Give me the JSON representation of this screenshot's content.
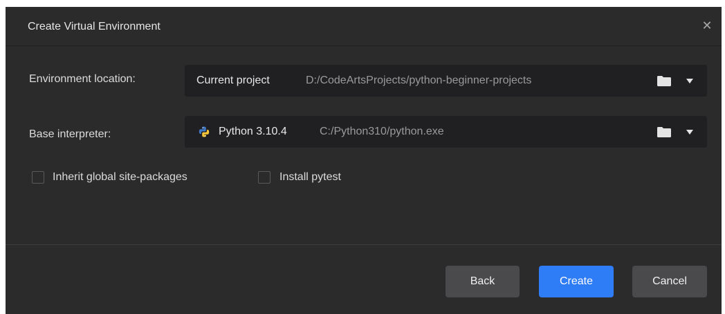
{
  "dialog": {
    "title": "Create Virtual Environment",
    "close_icon": "close-icon"
  },
  "environment_location": {
    "label": "Environment location:",
    "primary": "Current project",
    "path": "D:/CodeArtsProjects/python-beginner-projects"
  },
  "base_interpreter": {
    "label": "Base interpreter:",
    "primary": "Python 3.10.4",
    "path": "C:/Python310/python.exe"
  },
  "options": {
    "inherit_label": "Inherit global site-packages",
    "inherit_checked": false,
    "pytest_label": "Install pytest",
    "pytest_checked": false
  },
  "buttons": {
    "back": "Back",
    "create": "Create",
    "cancel": "Cancel"
  },
  "colors": {
    "background": "#2b2b2c",
    "field": "#202022",
    "accent": "#2e7cf6",
    "secondary_button": "#4a4a4c"
  }
}
